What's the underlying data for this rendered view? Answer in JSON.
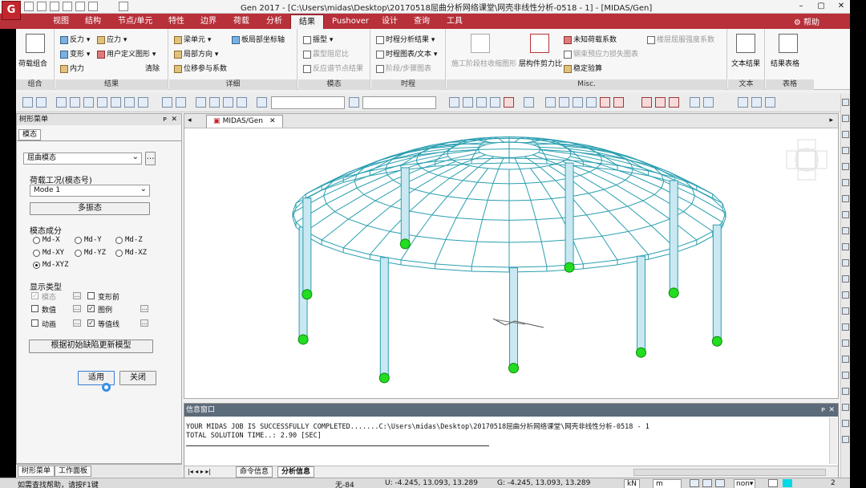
{
  "app": {
    "logo_text": "G",
    "title": "Gen 2017 - [C:\\Users\\midas\\Desktop\\20170518屈曲分析网络课堂\\网壳非线性分析-0518 - 1] - [MIDAS/Gen]",
    "help_label": "帮助"
  },
  "tabs": [
    "视图",
    "结构",
    "节点/单元",
    "特性",
    "边界",
    "荷载",
    "分析",
    "结果",
    "Pushover",
    "设计",
    "查询",
    "工具"
  ],
  "active_tab": "结果",
  "ribbon": {
    "groups": [
      "组合",
      "结果",
      "详细",
      "模态",
      "时程",
      "Misc.",
      "文本",
      "表格"
    ],
    "combo": "荷载组合",
    "results": [
      "反力",
      "应力",
      "变形",
      "用户定义图形",
      "内力",
      "清除"
    ],
    "detail": [
      "梁单元",
      "局部方向",
      "位移参与系数",
      "板局部坐标轴"
    ],
    "modal": [
      "振型",
      "震型阻尼比",
      "反应谱节点结果"
    ],
    "timehistory": [
      "时程分析结果",
      "时程图表/文本",
      "阶段/步骤图表"
    ],
    "misc": [
      "施工阶段柱收缩图形",
      "层构件剪力比",
      "未知荷载系数",
      "钢束预应力损失图表",
      "稳定验算",
      "楼层屈服强度系数"
    ],
    "text": "文本结果",
    "table": "结果表格"
  },
  "left_panel": {
    "header": "树形菜单",
    "tab": "模态",
    "mode_type": "屈曲模态",
    "load_case_label": "荷载工况(模态号)",
    "load_case_value": "Mode 1",
    "multi_mode_button": "多振态",
    "component_label": "模态成分",
    "components": [
      "Md-X",
      "Md-Y",
      "Md-Z",
      "Md-XY",
      "Md-YZ",
      "Md-XZ",
      "Md-XYZ"
    ],
    "selected_component": "Md-XYZ",
    "display_label": "显示类型",
    "display_options": [
      "模态",
      "变形前",
      "数值",
      "图例",
      "动画",
      "等值线"
    ],
    "update_button": "根据初始缺陷更新模型",
    "apply_button": "适用",
    "close_button": "关闭",
    "bottom_tabs": [
      "树形菜单",
      "工作面板"
    ]
  },
  "view": {
    "tab_label": "MIDAS/Gen"
  },
  "message_window": {
    "title": "信息窗口",
    "lines": [
      "YOUR MIDAS JOB IS SUCCESSFULLY COMPLETED.......C:\\Users\\midas\\Desktop\\20170518屈曲分析网络课堂\\网壳非线性分析-0518 - 1",
      "TOTAL SOLUTION TIME..:     2.90 [SEC]"
    ],
    "tabs": [
      "命令信息",
      "分析信息"
    ]
  },
  "status_bar": {
    "help_hint": "如需查找帮助，请按F1键",
    "node": "无-84",
    "u": "U: -4.245, 13.093, 13.289",
    "g": "G: -4.245, 13.093, 13.289",
    "unit_force": "kN",
    "unit_length": "m",
    "page": "2"
  },
  "colors": {
    "tab_bar": "#b7303a",
    "structure": "#2a9fb0",
    "supports": "#22dd22"
  }
}
